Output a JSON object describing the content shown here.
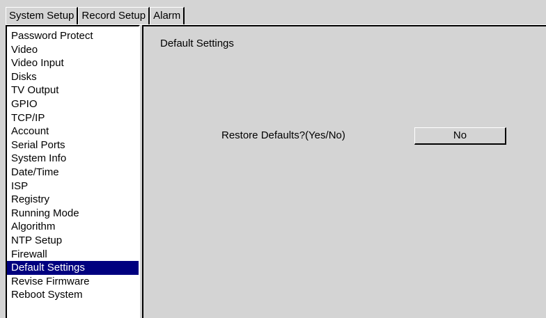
{
  "tabs": [
    {
      "label": "System Setup",
      "active": true
    },
    {
      "label": "Record Setup",
      "active": false
    },
    {
      "label": "Alarm",
      "active": false
    }
  ],
  "sidebar": {
    "selected_index": 17,
    "items": [
      {
        "label": "Password Protect"
      },
      {
        "label": "Video"
      },
      {
        "label": "Video Input"
      },
      {
        "label": "Disks"
      },
      {
        "label": "TV Output"
      },
      {
        "label": "GPIO"
      },
      {
        "label": "TCP/IP"
      },
      {
        "label": "Account"
      },
      {
        "label": "Serial Ports"
      },
      {
        "label": "System Info"
      },
      {
        "label": "Date/Time"
      },
      {
        "label": "ISP"
      },
      {
        "label": "Registry"
      },
      {
        "label": "Running Mode"
      },
      {
        "label": "Algorithm"
      },
      {
        "label": "NTP Setup"
      },
      {
        "label": "Firewall"
      },
      {
        "label": "Default Settings"
      },
      {
        "label": "Revise Firmware"
      },
      {
        "label": "Reboot System"
      }
    ]
  },
  "main": {
    "title": "Default Settings",
    "restore_label": "Restore Defaults?(Yes/No)",
    "restore_value": "No"
  },
  "colors": {
    "background": "#d4d4d4",
    "selection": "#00007f",
    "list_background": "#ffffff"
  }
}
